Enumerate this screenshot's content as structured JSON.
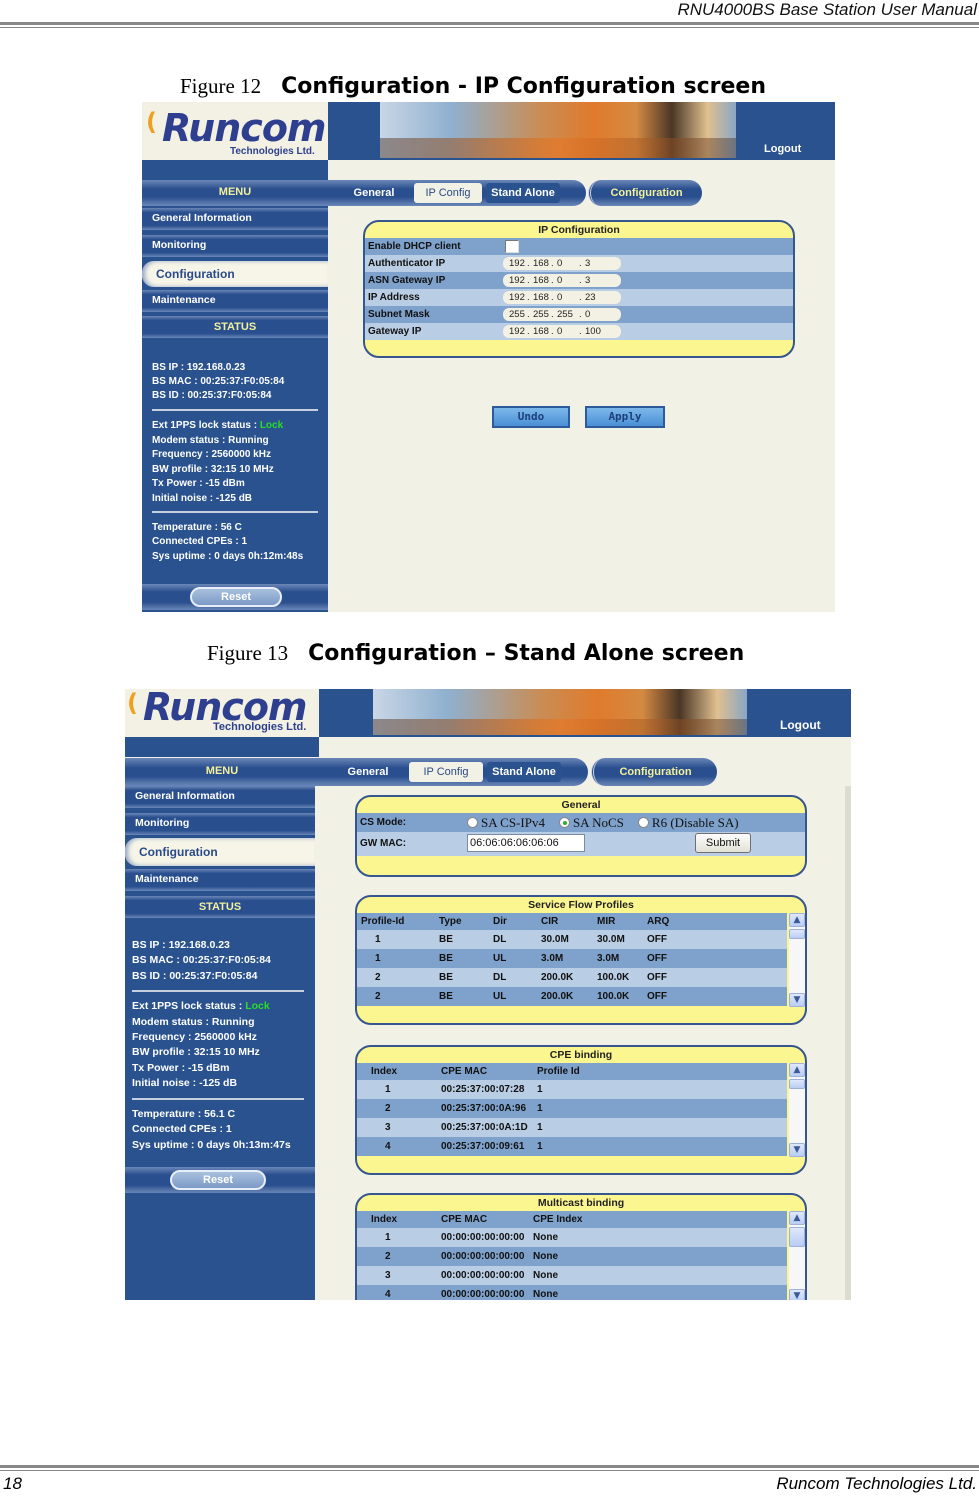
{
  "document": {
    "header": "RNU4000BS Base Station User Manual",
    "footer_page": "18",
    "footer_company": "Runcom Technologies Ltd.",
    "figure12": {
      "number": "Figure 12",
      "title": "Configuration - IP Configuration screen"
    },
    "figure13": {
      "number": "Figure 13",
      "title": "Configuration – Stand Alone screen"
    }
  },
  "app": {
    "logo_main": "Runcom",
    "logo_sub": "Technologies Ltd.",
    "logout": "Logout",
    "menu_label": "MENU",
    "tabs": [
      "General",
      "IP Config",
      "Stand Alone"
    ],
    "breadcrumb": "Configuration",
    "sidebar": [
      "General Information",
      "Monitoring",
      "Configuration",
      "Maintenance"
    ],
    "status_label": "STATUS",
    "reset_label": "Reset"
  },
  "screen1": {
    "status": {
      "bs_ip": "BS IP :  192.168.0.23",
      "bs_mac": "BS MAC :  00:25:37:F0:05:84",
      "bs_id": "BS ID :  00:25:37:F0:05:84",
      "lock_label": "Ext 1PPS lock status :  ",
      "lock_value": "Lock",
      "modem": "Modem status :  Running",
      "frequency": "Frequency :  2560000 kHz",
      "bw": "BW profile :  32:15 10 MHz",
      "tx": "Tx Power :  -15 dBm",
      "noise": "Initial noise :  -125 dB",
      "temperature": "Temperature :  56 C",
      "cpes": "Connected CPEs :  1",
      "uptime": "Sys uptime :  0 days 0h:12m:48s"
    },
    "ip_config": {
      "title": "IP Configuration",
      "dhcp_label": "Enable DHCP client",
      "dhcp_checked": false,
      "rows": [
        {
          "label": "Authenticator IP",
          "octets": [
            "192",
            "168",
            "0",
            "3"
          ]
        },
        {
          "label": "ASN Gateway IP",
          "octets": [
            "192",
            "168",
            "0",
            "3"
          ]
        },
        {
          "label": "IP Address",
          "octets": [
            "192",
            "168",
            "0",
            "23"
          ]
        },
        {
          "label": "Subnet Mask",
          "octets": [
            "255",
            "255",
            "255",
            "0"
          ]
        },
        {
          "label": "Gateway IP",
          "octets": [
            "192",
            "168",
            "0",
            "100"
          ]
        }
      ]
    },
    "undo_label": "Undo",
    "apply_label": "Apply"
  },
  "screen2": {
    "status": {
      "bs_ip": "BS IP :  192.168.0.23",
      "bs_mac": "BS MAC :  00:25:37:F0:05:84",
      "bs_id": "BS ID :  00:25:37:F0:05:84",
      "lock_label": "Ext 1PPS lock status :  ",
      "lock_value": "Lock",
      "modem": "Modem status :  Running",
      "frequency": "Frequency :  2560000 kHz",
      "bw": "BW profile :  32:15 10 MHz",
      "tx": "Tx Power :  -15 dBm",
      "noise": "Initial noise :  -125 dB",
      "temperature": "Temperature :  56.1 C",
      "cpes": "Connected CPEs :  1",
      "uptime": "Sys uptime :  0 days 0h:13m:47s"
    },
    "general": {
      "title": "General",
      "cs_mode_label": "CS Mode:",
      "cs_options": [
        "SA CS-IPv4",
        "SA NoCS",
        "R6 (Disable SA)"
      ],
      "cs_selected": 1,
      "gw_mac_label": "GW MAC:",
      "gw_mac_value": "06:06:06:06:06:06",
      "submit_label": "Submit"
    },
    "service_flow": {
      "title": "Service Flow Profiles",
      "headers": [
        "Profile-Id",
        "Type",
        "Dir",
        "CIR",
        "MIR",
        "ARQ"
      ],
      "rows": [
        [
          "1",
          "BE",
          "DL",
          "30.0M",
          "30.0M",
          "OFF"
        ],
        [
          "1",
          "BE",
          "UL",
          "3.0M",
          "3.0M",
          "OFF"
        ],
        [
          "2",
          "BE",
          "DL",
          "200.0K",
          "100.0K",
          "OFF"
        ],
        [
          "2",
          "BE",
          "UL",
          "200.0K",
          "100.0K",
          "OFF"
        ]
      ]
    },
    "cpe_binding": {
      "title": "CPE binding",
      "headers": [
        "Index",
        "CPE MAC",
        "Profile Id"
      ],
      "rows": [
        [
          "1",
          "00:25:37:00:07:28",
          "1"
        ],
        [
          "2",
          "00:25:37:00:0A:96",
          "1"
        ],
        [
          "3",
          "00:25:37:00:0A:1D",
          "1"
        ],
        [
          "4",
          "00:25:37:00:09:61",
          "1"
        ]
      ]
    },
    "multicast_binding": {
      "title": "Multicast binding",
      "headers": [
        "Index",
        "CPE MAC",
        "CPE Index"
      ],
      "rows": [
        [
          "1",
          "00:00:00:00:00:00",
          "None"
        ],
        [
          "2",
          "00:00:00:00:00:00",
          "None"
        ],
        [
          "3",
          "00:00:00:00:00:00",
          "None"
        ],
        [
          "4",
          "00:00:00:00:00:00",
          "None"
        ]
      ]
    }
  },
  "icons": {
    "scroll_up": "▲",
    "scroll_down": "▼"
  }
}
